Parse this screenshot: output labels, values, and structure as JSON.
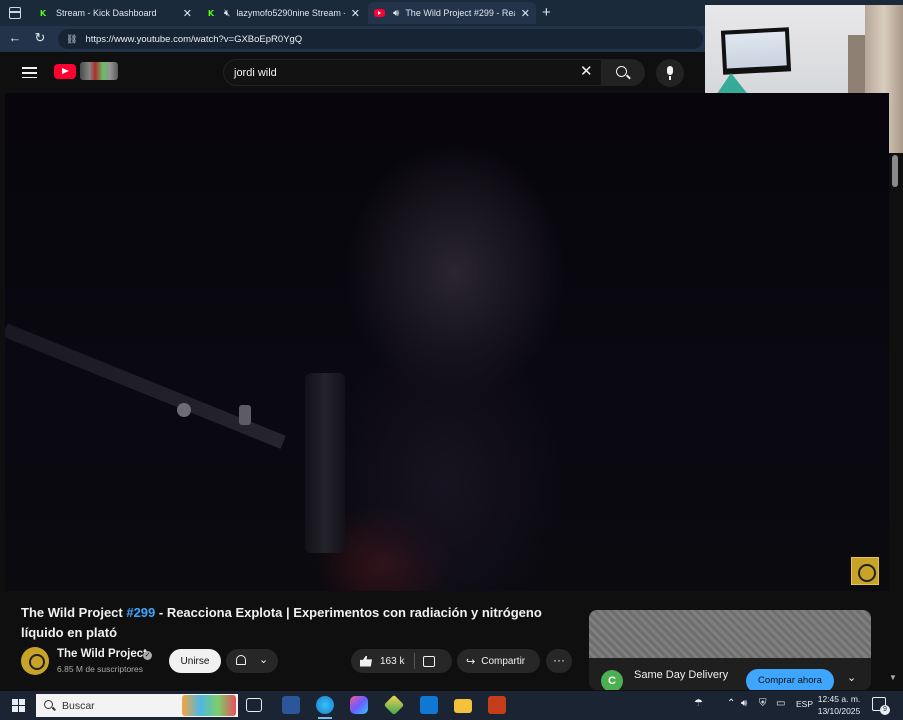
{
  "browser": {
    "tabs": [
      {
        "title": "Stream - Kick Dashboard",
        "favicon": "kick-icon",
        "active": false
      },
      {
        "title": "lazymofo5290nine Stream -",
        "favicon": "kick-icon",
        "muted": true,
        "active": false
      },
      {
        "title": "The Wild Project #299 - Rea",
        "favicon": "youtube-icon",
        "audio": true,
        "active": true
      }
    ],
    "new_tab": "+",
    "url": "https://www.youtube.com/watch?v=GXBoEpR0YgQ"
  },
  "youtube": {
    "search": {
      "value": "jordi wild"
    },
    "video": {
      "title_tag": "#299",
      "title_prefix": "The Wild Project ",
      "title_rest": " - Reacciona Explota | Experimentos con radiación y nitrógeno líquido en plató",
      "channel": "The Wild Project",
      "subscribers": "6.85 M de suscriptores",
      "join_label": "Unirse",
      "likes": "163 k",
      "share_label": "Compartir"
    },
    "ad": {
      "avatar_letter": "C",
      "title": "Same Day Delivery",
      "cta": "Comprar ahora"
    }
  },
  "taskbar": {
    "search_placeholder": "Buscar",
    "language": "ESP",
    "time": "12:45 a. m.",
    "date": "13/10/2025",
    "notifications": "9"
  },
  "colors": {
    "accent_blue": "#3ea6ff",
    "youtube_red": "#ff0033",
    "kick_green": "#53fc18"
  }
}
